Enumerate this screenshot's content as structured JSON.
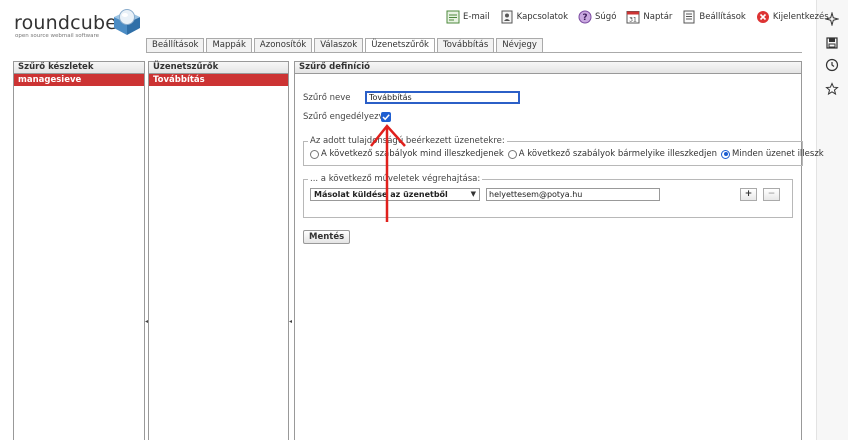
{
  "logo": {
    "word": "roundcube",
    "tagline": "open source webmail software"
  },
  "toolbar": [
    {
      "label": "E-mail",
      "icon": "mail-icon"
    },
    {
      "label": "Kapcsolatok",
      "icon": "contacts-icon"
    },
    {
      "label": "Súgó",
      "icon": "help-icon"
    },
    {
      "label": "Naptár",
      "icon": "calendar-icon",
      "calendar_day": "31"
    },
    {
      "label": "Beállítások",
      "icon": "settings-icon"
    },
    {
      "label": "Kijelentkezés",
      "icon": "logout-icon"
    }
  ],
  "tabs": [
    {
      "label": "Beállítások",
      "active": false
    },
    {
      "label": "Mappák",
      "active": false
    },
    {
      "label": "Azonosítók",
      "active": false
    },
    {
      "label": "Válaszok",
      "active": false
    },
    {
      "label": "Üzenetszűrők",
      "active": true
    },
    {
      "label": "Továbbítás",
      "active": false
    },
    {
      "label": "Névjegy",
      "active": false
    }
  ],
  "sets_panel": {
    "title": "Szűrő készletek",
    "selected": "managesieve"
  },
  "filters_panel": {
    "title": "Üzenetszűrők",
    "selected": "Továbbítás"
  },
  "definition": {
    "title": "Szűrő definíció",
    "name_label": "Szűrő neve",
    "name_value": "Továbbítás",
    "enabled_label": "Szűrő engedélyezve",
    "enabled": true,
    "rules_legend": "Az adott tulajdonságú beérkezett üzenetekre:",
    "rule_options": [
      {
        "label": "A következő szabályok mind illeszkedjenek",
        "checked": false
      },
      {
        "label": "A következő szabályok bármelyike illeszkedjen",
        "checked": false
      },
      {
        "label": "Minden üzenet illeszk",
        "checked": true
      }
    ],
    "actions_legend": "... a következő műveletek végrehajtása:",
    "action_selected": "Másolat küldése az üzenetből",
    "action_target": "helyettesem@potya.hu",
    "add_label": "+",
    "remove_label": "−",
    "save_label": "Mentés"
  },
  "colors": {
    "selection": "#cc3333",
    "focus": "#2b5fc7",
    "annotation_arrow": "#e0201c"
  }
}
